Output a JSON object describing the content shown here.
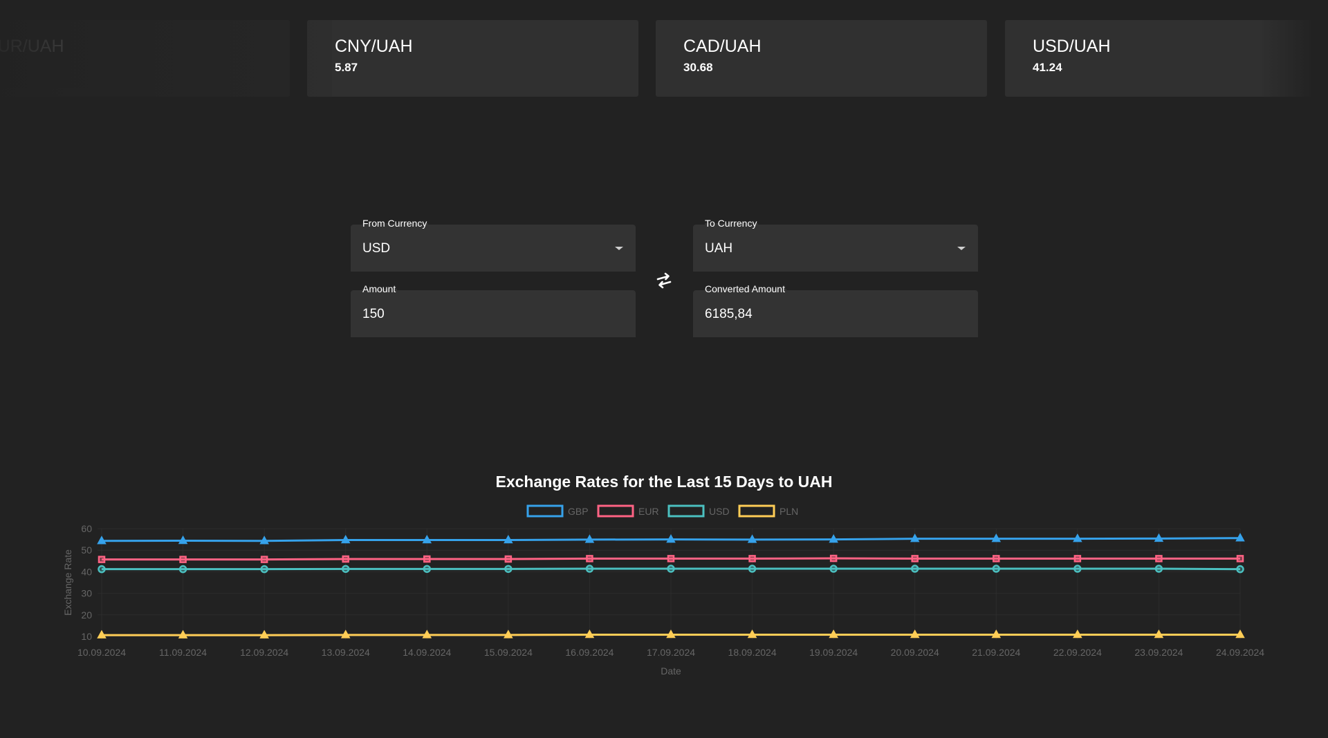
{
  "ticker": [
    {
      "pair": "EUR/UAH",
      "value": ""
    },
    {
      "pair": "CNY/UAH",
      "value": "5.87"
    },
    {
      "pair": "CAD/UAH",
      "value": "30.68"
    },
    {
      "pair": "USD/UAH",
      "value": "41.24"
    }
  ],
  "converter": {
    "from_label": "From Currency",
    "from_value": "USD",
    "to_label": "To Currency",
    "to_value": "UAH",
    "amount_label": "Amount",
    "amount_value": "150",
    "converted_label": "Converted Amount",
    "converted_value": "6185,84"
  },
  "chart_data": {
    "type": "line",
    "title": "Exchange Rates for the Last 15 Days to UAH",
    "xlabel": "Date",
    "ylabel": "Exchange Rate",
    "ylim": [
      10,
      60
    ],
    "yticks": [
      10,
      20,
      30,
      40,
      50,
      60
    ],
    "legend_position": "top",
    "grid": true,
    "categories": [
      "10.09.2024",
      "11.09.2024",
      "12.09.2024",
      "13.09.2024",
      "14.09.2024",
      "15.09.2024",
      "16.09.2024",
      "17.09.2024",
      "18.09.2024",
      "19.09.2024",
      "20.09.2024",
      "21.09.2024",
      "22.09.2024",
      "23.09.2024",
      "24.09.2024"
    ],
    "series": [
      {
        "name": "GBP",
        "color": "#36a2eb",
        "marker": "triangle",
        "values": [
          54.3,
          54.4,
          54.3,
          54.7,
          54.7,
          54.7,
          54.9,
          55.0,
          54.9,
          55.0,
          55.3,
          55.3,
          55.3,
          55.4,
          55.6
        ]
      },
      {
        "name": "EUR",
        "color": "#ff6384",
        "marker": "square",
        "values": [
          45.7,
          45.7,
          45.7,
          45.9,
          45.9,
          45.9,
          46.1,
          46.1,
          46.1,
          46.2,
          46.1,
          46.1,
          46.1,
          46.1,
          46.1
        ]
      },
      {
        "name": "USD",
        "color": "#4bc0c0",
        "marker": "circle",
        "values": [
          41.2,
          41.2,
          41.2,
          41.3,
          41.3,
          41.3,
          41.4,
          41.4,
          41.4,
          41.4,
          41.4,
          41.4,
          41.4,
          41.4,
          41.2
        ]
      },
      {
        "name": "PLN",
        "color": "#ffcd56",
        "marker": "triangle",
        "values": [
          10.6,
          10.6,
          10.6,
          10.7,
          10.7,
          10.7,
          10.8,
          10.8,
          10.8,
          10.8,
          10.8,
          10.8,
          10.8,
          10.8,
          10.8
        ]
      }
    ]
  }
}
